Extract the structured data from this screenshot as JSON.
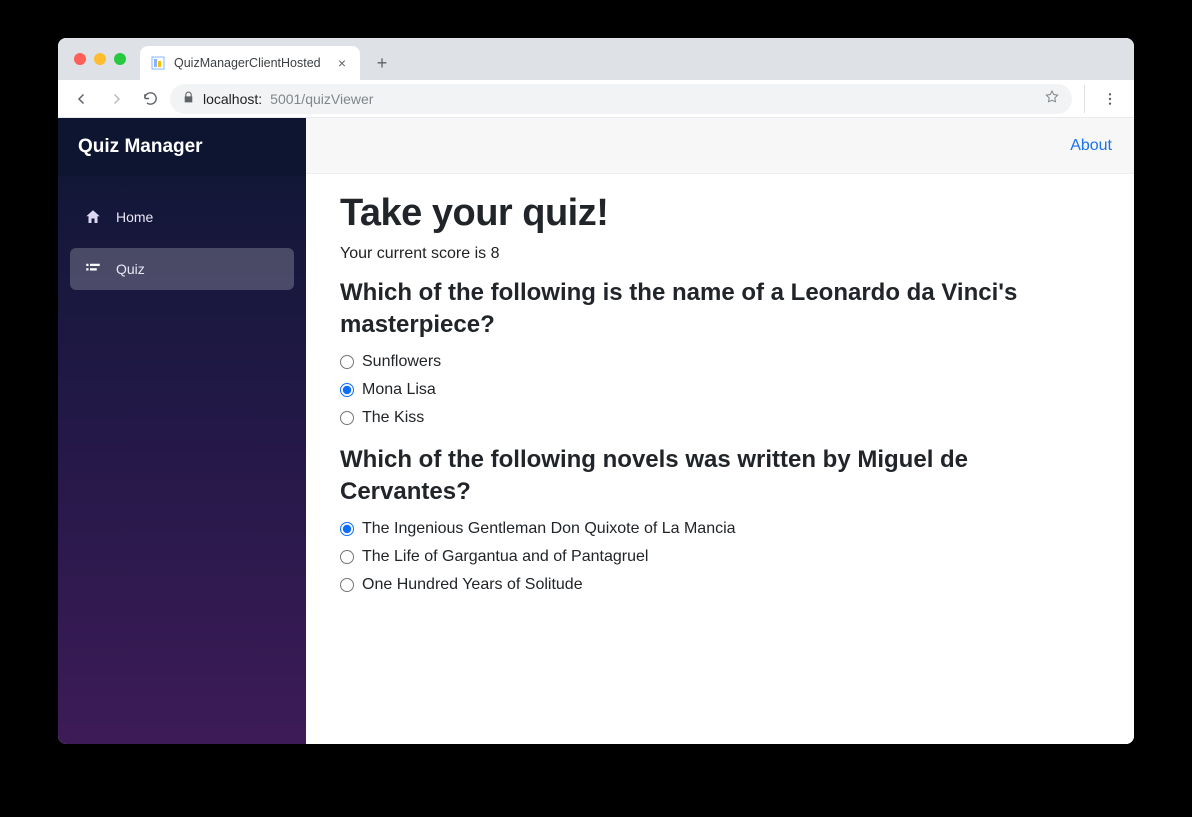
{
  "browser": {
    "tab_title": "QuizManagerClientHosted",
    "url_host": "localhost:",
    "url_port_path": "5001/quizViewer"
  },
  "sidebar": {
    "brand": "Quiz Manager",
    "items": [
      {
        "label": "Home",
        "active": false
      },
      {
        "label": "Quiz",
        "active": true
      }
    ]
  },
  "topbar": {
    "about": "About"
  },
  "quiz": {
    "title": "Take your quiz!",
    "score_prefix": "Your current score is ",
    "score_value": "8",
    "questions": [
      {
        "text": "Which of the following is the name of a Leonardo da Vinci's masterpiece?",
        "options": [
          {
            "label": "Sunflowers",
            "selected": false
          },
          {
            "label": "Mona Lisa",
            "selected": true
          },
          {
            "label": "The Kiss",
            "selected": false
          }
        ]
      },
      {
        "text": "Which of the following novels was written by Miguel de Cervantes?",
        "options": [
          {
            "label": "The Ingenious Gentleman Don Quixote of La Mancia",
            "selected": true
          },
          {
            "label": "The Life of Gargantua and of Pantagruel",
            "selected": false
          },
          {
            "label": "One Hundred Years of Solitude",
            "selected": false
          }
        ]
      }
    ]
  }
}
